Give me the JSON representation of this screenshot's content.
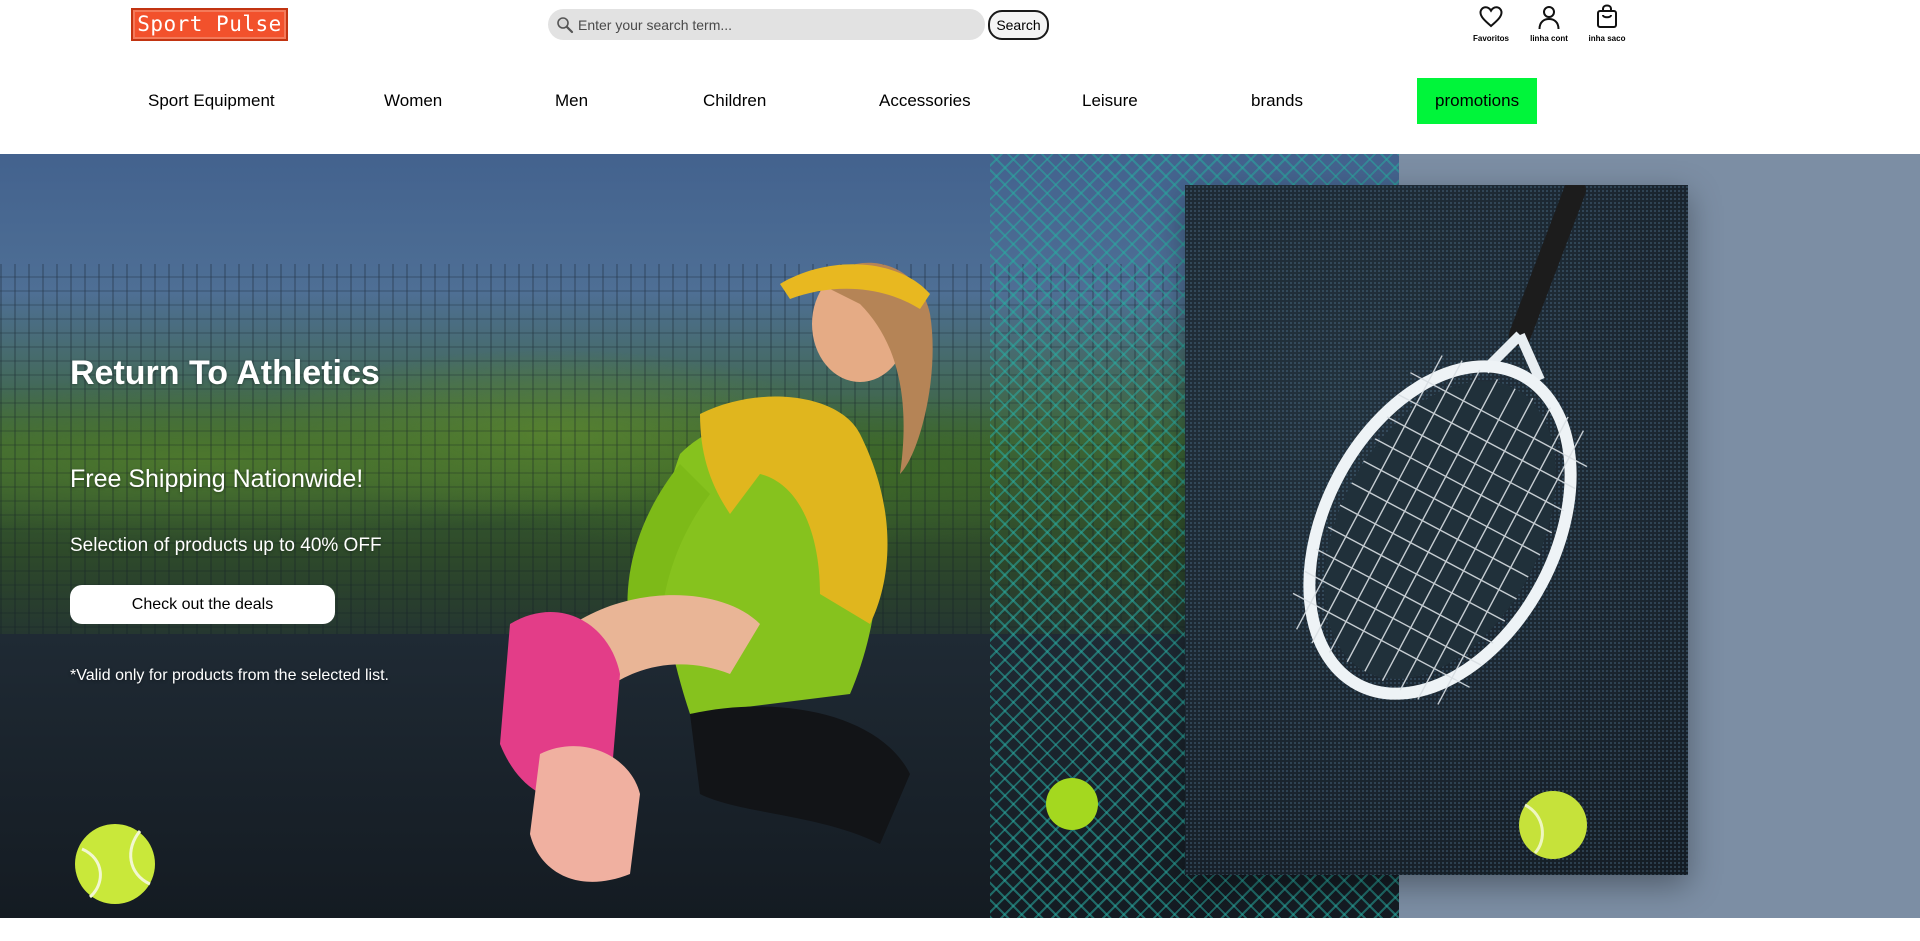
{
  "header": {
    "logo_text": "Sport Pulse",
    "search": {
      "placeholder": "Enter your search term...",
      "value": "",
      "button_label": "Search"
    },
    "icons": [
      {
        "label": "Favoritos",
        "icon": "heart-icon"
      },
      {
        "label": "linha cont",
        "icon": "user-icon"
      },
      {
        "label": "inha saco",
        "icon": "shopping-bag-icon"
      }
    ]
  },
  "nav": {
    "items": [
      {
        "label": "Sport Equipment"
      },
      {
        "label": "Women"
      },
      {
        "label": "Men"
      },
      {
        "label": "Children"
      },
      {
        "label": "Accessories"
      },
      {
        "label": "Leisure"
      },
      {
        "label": "brands"
      },
      {
        "label": "promotions",
        "highlight": true
      }
    ]
  },
  "hero": {
    "title": "Return To Athletics",
    "subtitle": "Free Shipping Nationwide!",
    "offer": "Selection of products up to 40% OFF",
    "cta_label": "Check out the deals",
    "note": "*Valid only for products from the selected list."
  },
  "colors": {
    "logo": "#f2512c",
    "promo_highlight": "#00f53a",
    "hero_bg": "#7c8ea4",
    "search_bg": "#e2e2e2"
  }
}
